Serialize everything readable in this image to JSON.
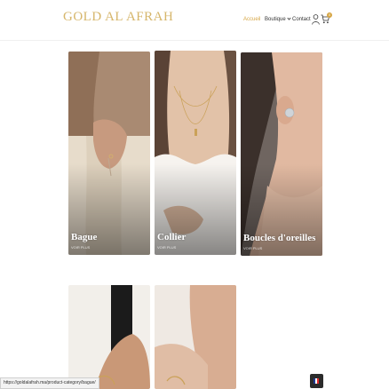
{
  "header": {
    "logo": "GOLD AL AFRAH",
    "nav": [
      {
        "label": "Accueil",
        "active": true
      },
      {
        "label": "Boutique",
        "has_dropdown": true
      },
      {
        "label": "Contact"
      }
    ],
    "cart_count": "0",
    "accent_color": "#d6a645",
    "icons": [
      "user-icon",
      "cart-icon"
    ]
  },
  "categories": [
    {
      "title": "Bague",
      "subtitle": "VOIR PLUS"
    },
    {
      "title": "Collier",
      "subtitle": "VOIR PLUS"
    },
    {
      "title": "Boucles d'oreilles",
      "subtitle": "VOIR PLUS"
    },
    {
      "title": "",
      "subtitle": ""
    },
    {
      "title": "",
      "subtitle": ""
    }
  ],
  "status_bar": {
    "url": "https://goldalafrah.ma/product-category/bague/"
  },
  "language": {
    "icon": "french-flag-icon"
  }
}
